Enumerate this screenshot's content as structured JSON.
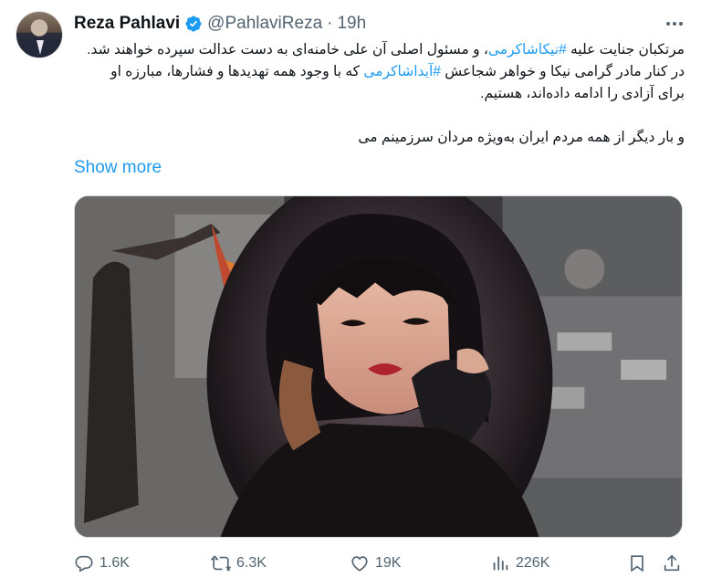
{
  "tweet": {
    "author_name": "Reza Pahlavi",
    "handle": "@PahlaviReza",
    "separator": "·",
    "time": "19h",
    "lines": [
      {
        "parts": [
          {
            "text": "مرتکبان جنایت علیه ",
            "tag": false
          },
          {
            "text": "#نیکاشاکرمی",
            "tag": true
          },
          {
            "text": "، و مسئول اصلی آن علی خامنه‌ای به دست عدالت سپرده خواهند شد.",
            "tag": false
          }
        ]
      },
      {
        "parts": [
          {
            "text": "در کنار مادر گرامی نیکا و خواهر شجاعش ",
            "tag": false
          },
          {
            "text": "#آیداشاکرمی",
            "tag": true
          },
          {
            "text": " که با وجود همه تهدیدها و فشارها، مبارزه او",
            "tag": false
          }
        ]
      },
      {
        "parts": [
          {
            "text": "برای آزادی را ادامه داده‌اند، هستیم.",
            "tag": false
          }
        ]
      },
      {
        "parts": [
          {
            "text": "",
            "tag": false
          }
        ]
      },
      {
        "parts": [
          {
            "text": "و بار دیگر از همه مردم ایران به‌ویژه مردان سرزمینم می",
            "tag": false
          }
        ]
      }
    ],
    "show_more": "Show more"
  },
  "actions": {
    "replies": "1.6K",
    "reposts": "6.3K",
    "likes": "19K",
    "views": "226K"
  },
  "icons": {
    "verified": "verified-badge-icon",
    "more": "more-options-icon",
    "reply": "reply-icon",
    "repost": "repost-icon",
    "like": "heart-icon",
    "views": "views-chart-icon",
    "bookmark": "bookmark-icon",
    "share": "share-icon"
  },
  "colors": {
    "accent": "#1d9bf0",
    "text": "#0f1419",
    "secondary": "#536471"
  }
}
